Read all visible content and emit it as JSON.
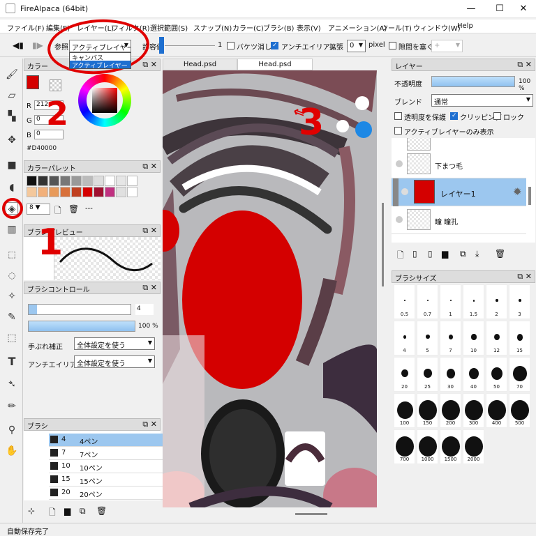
{
  "window": {
    "title": "FireAlpaca (64bit)",
    "minimize": "—",
    "maximize": "☐",
    "close": "✕"
  },
  "menu": [
    "ファイル(F)",
    "編集(E)",
    "レイヤー(L)",
    "フィルタ(R)",
    "選択範囲(S)",
    "スナップ(N)",
    "カラー(C)",
    "ブラシ(B)",
    "表示(V)",
    "アニメーション(A)",
    "ツール(T)",
    "ウィンドウ(W)",
    "Help"
  ],
  "toolopts": {
    "ref_label": "参照",
    "ref_value": "アクティブレイヤー",
    "ref_options": [
      "キャンバス",
      "アクティブレイヤー"
    ],
    "tolerance_label": "許容値",
    "tolerance_value": "1",
    "bucket_erase": "バケツ消し",
    "antialias": "アンチエイリアス",
    "expand_label": "拡張",
    "expand_value": "0",
    "pixel": "pixel",
    "gap_close": "隙間を塞ぐ",
    "plus": "+"
  },
  "color_panel": {
    "title": "カラー",
    "r_label": "R",
    "r_value": "212",
    "g_label": "G",
    "g_value": "0",
    "b_label": "B",
    "b_value": "0",
    "hex": "#D40000",
    "swatch": "#d40000"
  },
  "palette_panel": {
    "title": "カラーパレット",
    "count": "---"
  },
  "brush_preview": {
    "title": "ブラシプレビュー"
  },
  "brush_control": {
    "title": "ブラシコントロール",
    "size": "4",
    "opacity": "100",
    "pct": "%",
    "stabilizer_label": "手ぶれ補正",
    "stabilizer_value": "全体設定を使う",
    "aa_label": "アンチエイリアス",
    "aa_value": "全体設定を使う"
  },
  "brush_panel": {
    "title": "ブラシ",
    "items": [
      {
        "n": "4",
        "name": "4ペン"
      },
      {
        "n": "7",
        "name": "7ペン"
      },
      {
        "n": "10",
        "name": "10ペン"
      },
      {
        "n": "15",
        "name": "15ペン"
      },
      {
        "n": "20",
        "name": "20ペン"
      }
    ]
  },
  "tabs": [
    "Head.psd",
    "Head.psd"
  ],
  "layer_panel": {
    "title": "レイヤー",
    "opacity_label": "不透明度",
    "opacity_value": "100",
    "pct": "%",
    "blend_label": "ブレンド",
    "blend_value": "通常",
    "protect": "透明度を保護",
    "clipping": "クリッピング",
    "lock": "ロック",
    "active_only": "アクティブレイヤーのみ表示",
    "layers": [
      "下まつ毛",
      "レイヤー1",
      "瞳 瞳孔"
    ]
  },
  "brush_size": {
    "title": "ブラシサイズ",
    "sizes": [
      "0.5",
      "0.7",
      "1",
      "1.5",
      "2",
      "3",
      "4",
      "5",
      "7",
      "10",
      "12",
      "15",
      "20",
      "25",
      "30",
      "40",
      "50",
      "70",
      "100",
      "150",
      "200",
      "300",
      "400",
      "500",
      "700",
      "1000",
      "1500",
      "2000"
    ]
  },
  "annotations": {
    "one": "1",
    "two": "2",
    "three": "3"
  },
  "status": "自動保存完了",
  "colors": {
    "accent": "#1e6fd0",
    "red": "#d40000",
    "annotation": "#e00000"
  }
}
